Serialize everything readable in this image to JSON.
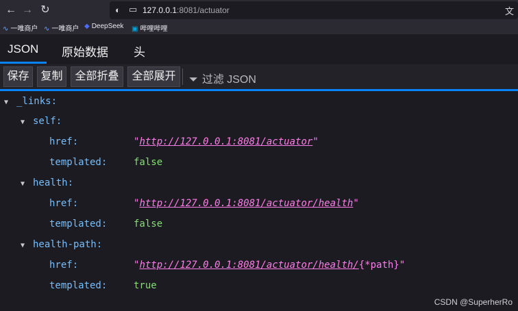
{
  "browser": {
    "url_host": "127.0.0.1",
    "url_rest": ":8081/actuator",
    "bookmarks": [
      "一唯商户",
      "一唯商户",
      "DeepSeek",
      "哔哩哔哩"
    ]
  },
  "tabs": [
    "JSON",
    "原始数据",
    "头"
  ],
  "toolbar": {
    "save": "保存",
    "copy": "复制",
    "collapse_all": "全部折叠",
    "expand_all": "全部展开",
    "filter": "过滤 JSON"
  },
  "tree": {
    "links_key": "_links:",
    "self": {
      "key": "self:",
      "href_key": "href:",
      "href_url": "http://127.0.0.1:8081/actuator",
      "templated_key": "templated:",
      "templated_val": "false"
    },
    "health": {
      "key": "health:",
      "href_key": "href:",
      "href_url": "http://127.0.0.1:8081/actuator/health",
      "templated_key": "templated:",
      "templated_val": "false"
    },
    "health_path": {
      "key": "health-path:",
      "href_key": "href:",
      "href_url": "http://127.0.0.1:8081/actuator/health/",
      "href_suffix": "{*path}",
      "templated_key": "templated:",
      "templated_val": "true"
    }
  },
  "watermark": "CSDN @SuperherRo"
}
